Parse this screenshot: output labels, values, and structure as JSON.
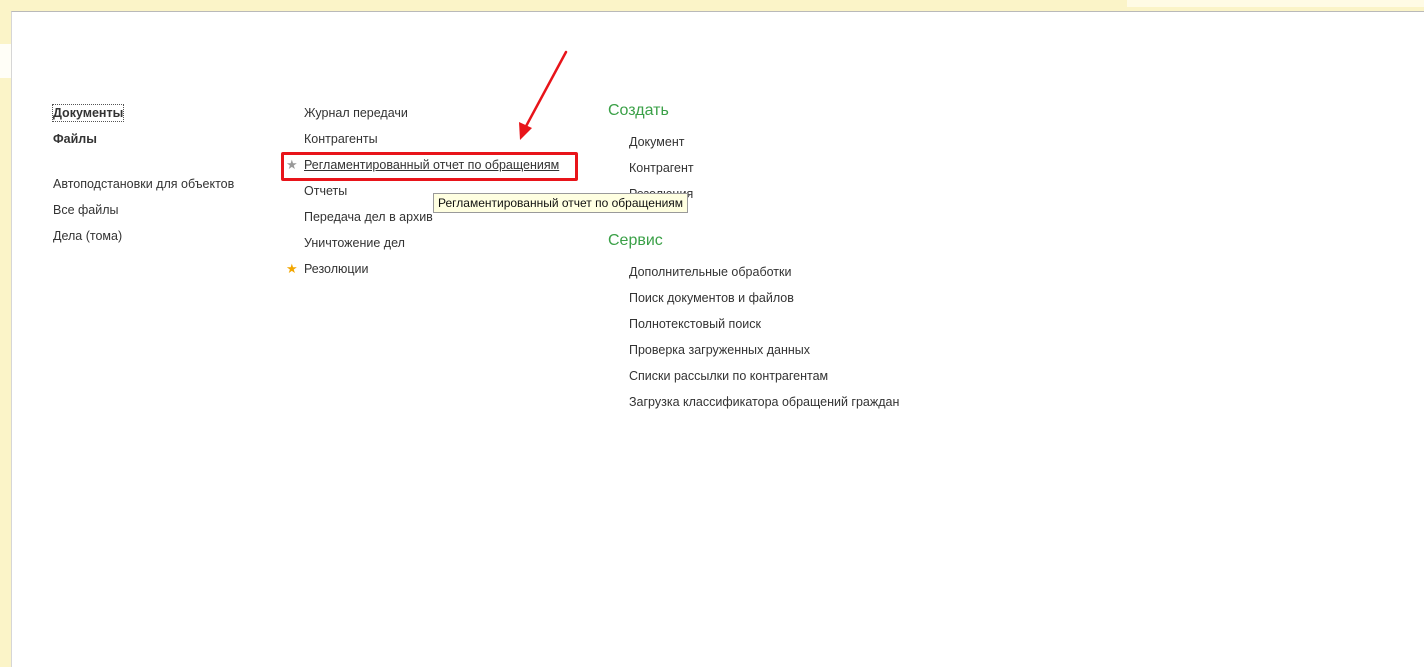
{
  "navigation": {
    "main": [
      {
        "label": "Документы"
      },
      {
        "label": "Файлы"
      }
    ],
    "additional": [
      {
        "label": "Автоподстановки для объектов"
      },
      {
        "label": "Все файлы"
      },
      {
        "label": "Дела (тома)"
      }
    ]
  },
  "reports_list": [
    {
      "label": "Журнал передачи"
    },
    {
      "label": "Контрагенты"
    },
    {
      "label": "Регламентированный отчет по обращениям",
      "favorite_icon": "star-icon-gray",
      "highlighted": true
    },
    {
      "label": "Отчеты"
    },
    {
      "label": "Передача дел в архив"
    },
    {
      "label": "Уничтожение дел"
    },
    {
      "label": "Резолюции",
      "favorite_icon": "star-icon-gold"
    }
  ],
  "create_section": {
    "title": "Создать",
    "items": [
      {
        "label": "Документ"
      },
      {
        "label": "Контрагент"
      },
      {
        "label": "Резолюция"
      }
    ]
  },
  "service_section": {
    "title": "Сервис",
    "items": [
      {
        "label": "Дополнительные обработки"
      },
      {
        "label": "Поиск документов и файлов"
      },
      {
        "label": "Полнотекстовый поиск"
      },
      {
        "label": "Проверка загруженных данных"
      },
      {
        "label": "Списки рассылки по контрагентам"
      },
      {
        "label": "Загрузка классификатора обращений граждан"
      }
    ]
  },
  "tooltip": {
    "text": "Регламентированный отчет по обращениям"
  },
  "colors": {
    "section_title": "#3aa047",
    "annotation_red": "#e8141a",
    "favorite_gold": "#f2a600",
    "background_yellow": "#fbf4c8"
  }
}
